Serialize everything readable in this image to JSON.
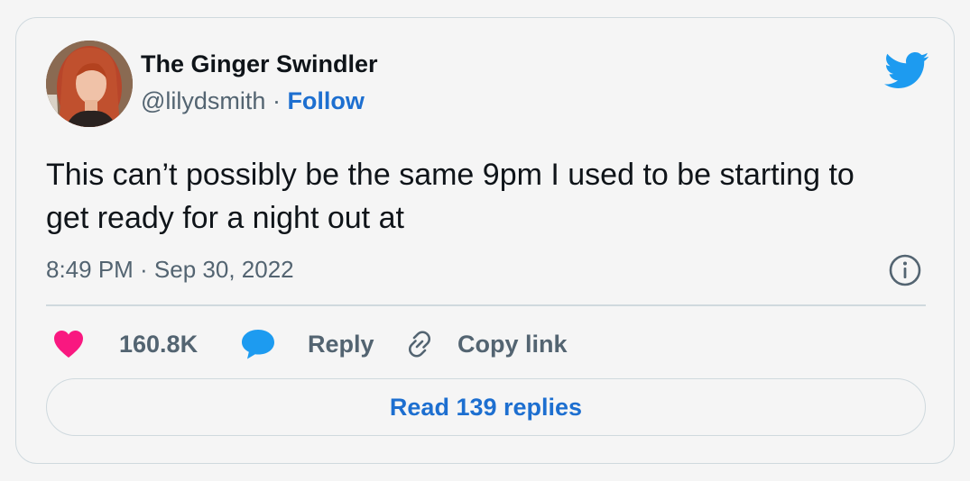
{
  "author": {
    "display_name": "The Ginger Swindler",
    "handle": "@lilydsmith",
    "separator": " · ",
    "follow_label": "Follow"
  },
  "tweet": {
    "text": "This can’t possibly be the same 9pm I used to be starting to get ready for a night out at",
    "timestamp": "8:49 PM · Sep 30, 2022"
  },
  "actions": {
    "like_count": "160.8K",
    "reply_label": "Reply",
    "copy_link_label": "Copy link"
  },
  "read_replies_label": "Read 139 replies",
  "icons": {
    "logo": "twitter-bird-icon",
    "info": "info-icon",
    "like": "heart-icon",
    "reply": "speech-bubble-icon",
    "copy": "link-icon"
  },
  "colors": {
    "accent": "#1d9bf0",
    "link": "#1d6fd0",
    "like": "#f91880",
    "muted": "#536471",
    "text": "#0f1419",
    "border": "#cfd9de"
  }
}
